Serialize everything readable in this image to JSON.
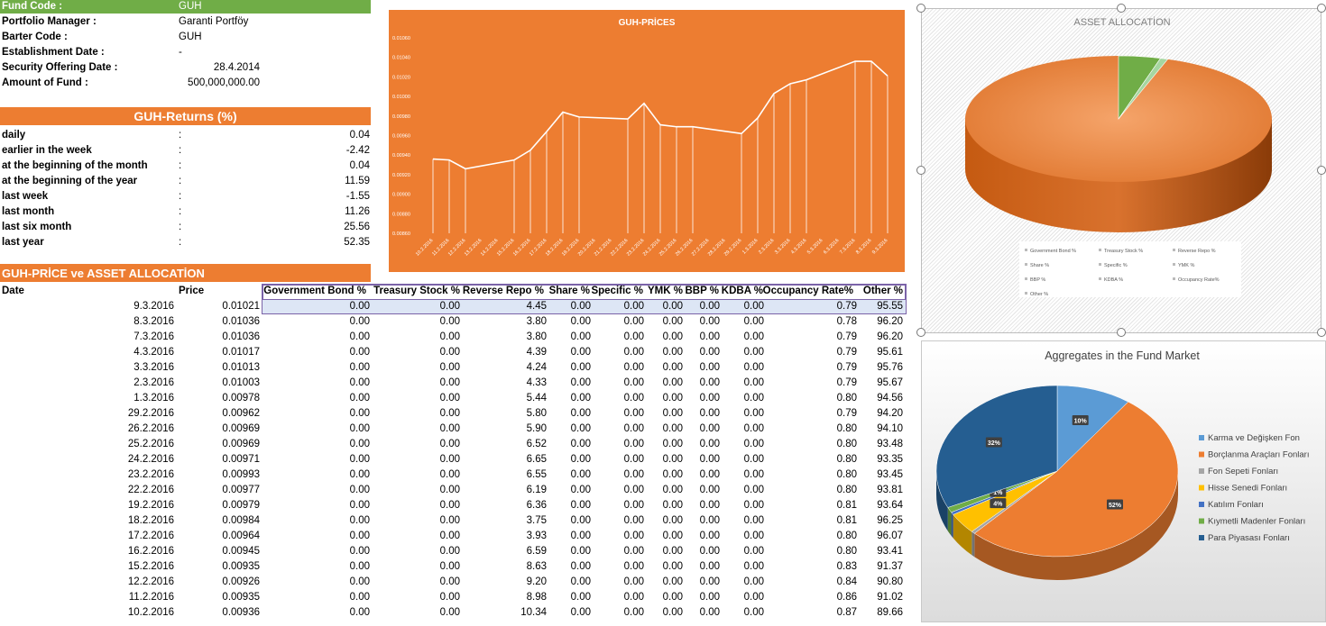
{
  "fund_info": {
    "rows": [
      {
        "label": "Fund Code :",
        "value": "GUH"
      },
      {
        "label": "Portfolio Manager :",
        "value": "Garanti Portföy"
      },
      {
        "label": "Barter Code :",
        "value": "GUH"
      },
      {
        "label": "Establishment Date :",
        "value": "-"
      },
      {
        "label": "Security Offering Date :",
        "value": "28.4.2014"
      },
      {
        "label": "Amount of Fund :",
        "value": "500,000,000.00"
      }
    ]
  },
  "returns": {
    "title": "GUH-Returns (%)",
    "rows": [
      {
        "label": "daily",
        "sep": ":",
        "value": "0.04"
      },
      {
        "label": "earlier in the week",
        "sep": ":",
        "value": "-2.42"
      },
      {
        "label": "at the beginning of the month",
        "sep": ":",
        "value": "0.04"
      },
      {
        "label": "at the beginning of the year",
        "sep": ":",
        "value": "11.59"
      },
      {
        "label": "last week",
        "sep": ":",
        "value": "-1.55"
      },
      {
        "label": "last month",
        "sep": ":",
        "value": "11.26"
      },
      {
        "label": "last six month",
        "sep": ":",
        "value": "25.56"
      },
      {
        "label": "last year",
        "sep": ":",
        "value": "52.35"
      }
    ]
  },
  "allocation_table": {
    "title": "GUH-PRİCE ve ASSET ALLOCATİON",
    "headers": [
      "Date",
      "Price",
      "Government Bond %",
      "Treasury Stock %",
      "Reverse Repo %",
      "Share %",
      "Specific %",
      "YMK %",
      "BBP %",
      "KDBA %",
      "Occupancy Rate%",
      "Other %"
    ],
    "rows": [
      [
        "9.3.2016",
        "0.01021",
        "0.00",
        "0.00",
        "4.45",
        "0.00",
        "0.00",
        "0.00",
        "0.00",
        "0.00",
        "0.79",
        "95.55"
      ],
      [
        "8.3.2016",
        "0.01036",
        "0.00",
        "0.00",
        "3.80",
        "0.00",
        "0.00",
        "0.00",
        "0.00",
        "0.00",
        "0.78",
        "96.20"
      ],
      [
        "7.3.2016",
        "0.01036",
        "0.00",
        "0.00",
        "3.80",
        "0.00",
        "0.00",
        "0.00",
        "0.00",
        "0.00",
        "0.79",
        "96.20"
      ],
      [
        "4.3.2016",
        "0.01017",
        "0.00",
        "0.00",
        "4.39",
        "0.00",
        "0.00",
        "0.00",
        "0.00",
        "0.00",
        "0.79",
        "95.61"
      ],
      [
        "3.3.2016",
        "0.01013",
        "0.00",
        "0.00",
        "4.24",
        "0.00",
        "0.00",
        "0.00",
        "0.00",
        "0.00",
        "0.79",
        "95.76"
      ],
      [
        "2.3.2016",
        "0.01003",
        "0.00",
        "0.00",
        "4.33",
        "0.00",
        "0.00",
        "0.00",
        "0.00",
        "0.00",
        "0.79",
        "95.67"
      ],
      [
        "1.3.2016",
        "0.00978",
        "0.00",
        "0.00",
        "5.44",
        "0.00",
        "0.00",
        "0.00",
        "0.00",
        "0.00",
        "0.80",
        "94.56"
      ],
      [
        "29.2.2016",
        "0.00962",
        "0.00",
        "0.00",
        "5.80",
        "0.00",
        "0.00",
        "0.00",
        "0.00",
        "0.00",
        "0.79",
        "94.20"
      ],
      [
        "26.2.2016",
        "0.00969",
        "0.00",
        "0.00",
        "5.90",
        "0.00",
        "0.00",
        "0.00",
        "0.00",
        "0.00",
        "0.80",
        "94.10"
      ],
      [
        "25.2.2016",
        "0.00969",
        "0.00",
        "0.00",
        "6.52",
        "0.00",
        "0.00",
        "0.00",
        "0.00",
        "0.00",
        "0.80",
        "93.48"
      ],
      [
        "24.2.2016",
        "0.00971",
        "0.00",
        "0.00",
        "6.65",
        "0.00",
        "0.00",
        "0.00",
        "0.00",
        "0.00",
        "0.80",
        "93.35"
      ],
      [
        "23.2.2016",
        "0.00993",
        "0.00",
        "0.00",
        "6.55",
        "0.00",
        "0.00",
        "0.00",
        "0.00",
        "0.00",
        "0.80",
        "93.45"
      ],
      [
        "22.2.2016",
        "0.00977",
        "0.00",
        "0.00",
        "6.19",
        "0.00",
        "0.00",
        "0.00",
        "0.00",
        "0.00",
        "0.80",
        "93.81"
      ],
      [
        "19.2.2016",
        "0.00979",
        "0.00",
        "0.00",
        "6.36",
        "0.00",
        "0.00",
        "0.00",
        "0.00",
        "0.00",
        "0.81",
        "93.64"
      ],
      [
        "18.2.2016",
        "0.00984",
        "0.00",
        "0.00",
        "3.75",
        "0.00",
        "0.00",
        "0.00",
        "0.00",
        "0.00",
        "0.81",
        "96.25"
      ],
      [
        "17.2.2016",
        "0.00964",
        "0.00",
        "0.00",
        "3.93",
        "0.00",
        "0.00",
        "0.00",
        "0.00",
        "0.00",
        "0.80",
        "96.07"
      ],
      [
        "16.2.2016",
        "0.00945",
        "0.00",
        "0.00",
        "6.59",
        "0.00",
        "0.00",
        "0.00",
        "0.00",
        "0.00",
        "0.80",
        "93.41"
      ],
      [
        "15.2.2016",
        "0.00935",
        "0.00",
        "0.00",
        "8.63",
        "0.00",
        "0.00",
        "0.00",
        "0.00",
        "0.00",
        "0.83",
        "91.37"
      ],
      [
        "12.2.2016",
        "0.00926",
        "0.00",
        "0.00",
        "9.20",
        "0.00",
        "0.00",
        "0.00",
        "0.00",
        "0.00",
        "0.84",
        "90.80"
      ],
      [
        "11.2.2016",
        "0.00935",
        "0.00",
        "0.00",
        "8.98",
        "0.00",
        "0.00",
        "0.00",
        "0.00",
        "0.00",
        "0.86",
        "91.02"
      ],
      [
        "10.2.2016",
        "0.00936",
        "0.00",
        "0.00",
        "10.34",
        "0.00",
        "0.00",
        "0.00",
        "0.00",
        "0.00",
        "0.87",
        "89.66"
      ]
    ]
  },
  "chart_data": [
    {
      "type": "area",
      "title": "GUH-PRİCES",
      "xlabel": "",
      "ylabel": "",
      "ylim": [
        0.0086,
        0.0106
      ],
      "yticks": [
        "0.00860",
        "0.00880",
        "0.00900",
        "0.00920",
        "0.00940",
        "0.00960",
        "0.00980",
        "0.01000",
        "0.01020",
        "0.01040",
        "0.01060"
      ],
      "grid": false,
      "x": [
        "10.2.2016",
        "11.2.2016",
        "12.2.2016",
        "13.2.2016",
        "14.2.2016",
        "15.2.2016",
        "16.2.2016",
        "17.2.2016",
        "18.2.2016",
        "19.2.2016",
        "20.2.2016",
        "21.2.2016",
        "22.2.2016",
        "23.2.2016",
        "24.2.2016",
        "25.2.2016",
        "26.2.2016",
        "27.2.2016",
        "28.2.2016",
        "29.2.2016",
        "1.3.2016",
        "2.3.2016",
        "3.3.2016",
        "4.3.2016",
        "5.3.2016",
        "6.3.2016",
        "7.3.2016",
        "8.3.2016",
        "9.3.2016"
      ],
      "series": [
        {
          "values": [
            0.00936,
            0.00935,
            0.00926,
            null,
            null,
            0.00935,
            0.00945,
            0.00964,
            0.00984,
            0.00979,
            null,
            null,
            0.00977,
            0.00993,
            0.00971,
            0.00969,
            0.00969,
            null,
            null,
            0.00962,
            0.00978,
            0.01003,
            0.01013,
            0.01017,
            null,
            null,
            0.01036,
            0.01036,
            0.01021
          ]
        }
      ],
      "colors": {
        "background": "#ed7d31",
        "line": "#ffffff"
      }
    },
    {
      "type": "pie",
      "title": "ASSET ALLOCATİON",
      "categories": [
        "Government Bond %",
        "Treasury Stock %",
        "Reverse Repo %",
        "Share %",
        "Specific %",
        "YMK %",
        "BBP %",
        "KDBA %",
        "Occupancy Rate%",
        "Other %"
      ],
      "values": [
        0.0,
        0.0,
        4.45,
        0.0,
        0.0,
        0.0,
        0.0,
        0.0,
        0.79,
        95.55
      ],
      "colors": [
        "#5b9bd5",
        "#ed7d31",
        "#a5a5a5",
        "#ffc000",
        "#4472c4",
        "#70ad47",
        "#255e91",
        "#9e480e",
        "#636363",
        "#ed7d31"
      ],
      "legend": "bottom"
    },
    {
      "type": "pie",
      "title": "Aggregates in the Fund Market",
      "categories": [
        "Karma ve Değişken Fon",
        "Borçlanma Araçları Fonları",
        "Fon Sepeti Fonları",
        "Hisse Senedi Fonları",
        "Katılım Fonları",
        "Kıymetli Madenler Fonları",
        "Para Piyasası Fonları"
      ],
      "values": [
        10,
        52,
        0.5,
        4,
        0.5,
        1,
        32
      ],
      "data_labels": [
        "10%",
        "52%",
        "",
        "4%",
        "",
        "1%",
        "32%"
      ],
      "colors": [
        "#5b9bd5",
        "#ed7d31",
        "#a5a5a5",
        "#ffc000",
        "#4472c4",
        "#70ad47",
        "#255e91"
      ],
      "legend": "right"
    }
  ]
}
